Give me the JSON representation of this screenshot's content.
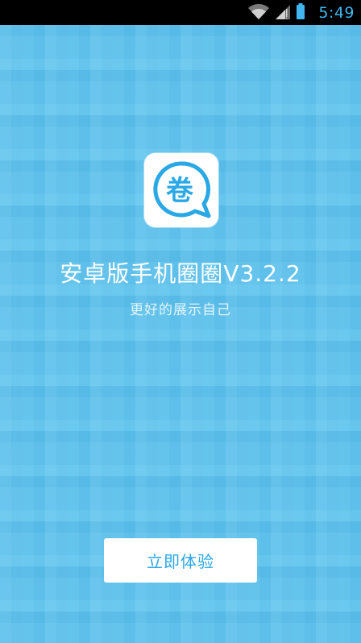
{
  "status_bar": {
    "time": "5:49",
    "icons": [
      "wifi-icon",
      "signal-icon",
      "battery-icon"
    ]
  },
  "app": {
    "logo_icon": "quan-chat-bubble-icon",
    "logo_glyph": "卷",
    "title": "安卓版手机圈圈V3.2.2",
    "subtitle": "更好的展示自己"
  },
  "actions": {
    "start_label": "立即体验"
  },
  "colors": {
    "background": "#5ec4ee",
    "accent": "#2aa8e6",
    "status_time": "#3fb6f0"
  }
}
